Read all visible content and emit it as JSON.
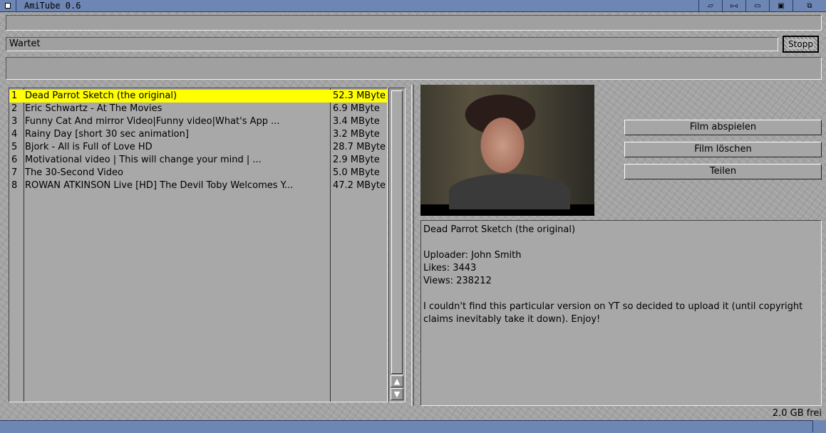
{
  "window": {
    "title": "AmiTube 0.6"
  },
  "status": {
    "text": "Wartet",
    "stop_label": "Stopp"
  },
  "videos": [
    {
      "num": "1",
      "title": "Dead Parrot Sketch (the original)",
      "size": "52.3 MByte"
    },
    {
      "num": "2",
      "title": "Eric Schwartz - At The Movies",
      "size": "6.9 MByte"
    },
    {
      "num": "3",
      "title": "Funny Cat And mirror Video|Funny video|What's App ...",
      "size": "3.4 MByte"
    },
    {
      "num": "4",
      "title": "Rainy Day [short 30 sec animation]",
      "size": "3.2 MByte"
    },
    {
      "num": "5",
      "title": "Bjork - All is Full of Love HD",
      "size": "28.7 MByte"
    },
    {
      "num": "6",
      "title": "Motivational video | This will change your mind | ...",
      "size": "2.9 MByte"
    },
    {
      "num": "7",
      "title": "The 30-Second Video",
      "size": "5.0 MByte"
    },
    {
      "num": "8",
      "title": "ROWAN ATKINSON Live [HD] The Devil Toby Welcomes Y...",
      "size": "47.2 MByte"
    }
  ],
  "actions": {
    "play": "Film abspielen",
    "delete": "Film löschen",
    "share": "Teilen"
  },
  "details": {
    "title": "Dead Parrot Sketch (the original)",
    "uploader": "Uploader: John Smith",
    "likes": "Likes: 3443",
    "views": "Views: 238212",
    "description": "I couldn't find this particular version on YT so decided to upload it (until copyright claims inevitably take it down). Enjoy!"
  },
  "footer": {
    "free_space": "2.0 GB frei"
  },
  "colors": {
    "titlebar": "#6d86b4",
    "selection": "#ffff00"
  },
  "icons": [
    "close-gadget-icon",
    "snapshot-icon",
    "iconify-icon",
    "zoom-icon",
    "depth-icon",
    "resize-icon",
    "scroll-up-icon",
    "scroll-down-icon"
  ]
}
